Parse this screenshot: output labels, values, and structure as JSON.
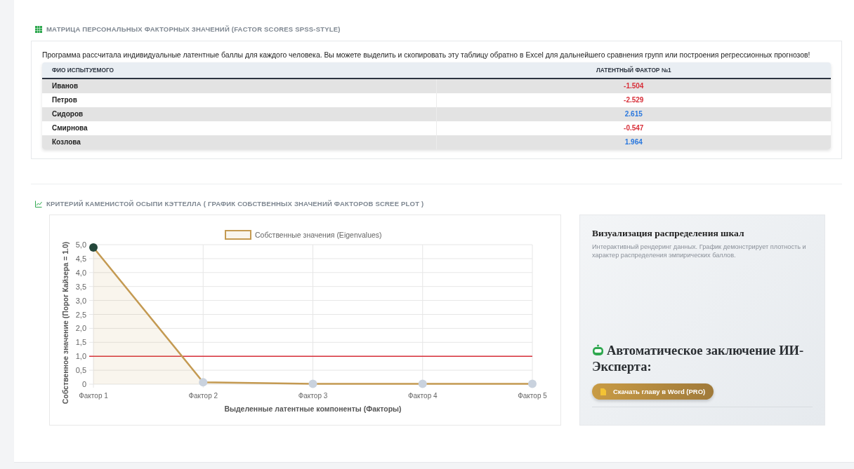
{
  "scores_section": {
    "title": "МАТРИЦА ПЕРСОНАЛЬНЫХ ФАКТОРНЫХ ЗНАЧЕНИЙ (FACTOR SCORES SPSS-STYLE)",
    "description": "Программа рассчитала индивидуальные латентные баллы для каждого человека. Вы можете выделить и скопировать эту таблицу обратно в Excel для дальнейшего сравнения групп или построения регрессионных прогнозов!",
    "table": {
      "columns": [
        "ФИО ИСПЫТУЕМОГО",
        "ЛАТЕНТНЫЙ ФАКТОР №1"
      ],
      "rows": [
        {
          "name": "Иванов",
          "score": "-1.504",
          "color": "#d8303a"
        },
        {
          "name": "Петров",
          "score": "-2.529",
          "color": "#d8303a"
        },
        {
          "name": "Сидоров",
          "score": "2.615",
          "color": "#2a78de"
        },
        {
          "name": "Смирнова",
          "score": "-0.547",
          "color": "#d8303a"
        },
        {
          "name": "Козлова",
          "score": "1.964",
          "color": "#2a78de"
        }
      ]
    }
  },
  "scree_section": {
    "title": "КРИТЕРИЙ КАМЕНИСТОЙ ОСЫПИ КЭТТЕЛЛА ( ГРАФИК СОБСТВЕННЫХ ЗНАЧЕНИЙ ФАКТОРОВ SCREE PLOT )",
    "chart_data": {
      "type": "area",
      "xlabel": "Выделенные латентные компоненты (Факторы)",
      "ylabel": "Собственное значение (Порог Кайзера = 1.0)",
      "categories": [
        "Фактор 1",
        "Фактор 2",
        "Фактор 3",
        "Фактор 4",
        "Фактор 5"
      ],
      "series": [
        {
          "name": "Собственные значения (Eigenvalues)",
          "color": "#c49a52",
          "values": [
            4.9,
            0.07,
            0.01,
            0.01,
            0.01
          ]
        }
      ],
      "ylim": [
        0,
        5
      ],
      "yticks": [
        {
          "value": 0,
          "label": "0"
        },
        {
          "value": 0.5,
          "label": "0,5"
        },
        {
          "value": 1,
          "label": "1,0"
        },
        {
          "value": 1.5,
          "label": "1,5"
        },
        {
          "value": 2,
          "label": "2,0"
        },
        {
          "value": 2.5,
          "label": "2,5"
        },
        {
          "value": 3,
          "label": "3,0"
        },
        {
          "value": 3.5,
          "label": "3,5"
        },
        {
          "value": 4,
          "label": "4,0"
        },
        {
          "value": 4.5,
          "label": "4,5"
        },
        {
          "value": 5,
          "label": "5,0"
        }
      ],
      "grid": true,
      "ref_lines": [
        {
          "axis": "y",
          "value": 1,
          "color": "#d8303a"
        }
      ]
    },
    "side_card": {
      "title": "Визуализация распределения шкал",
      "description": "Интерактивный рендеринг данных. График демонстрирует плотность и характер распределения эмпирических баллов.",
      "conclusion_title": "Автоматическое заключение ИИ-Эксперта:",
      "download_button": "Скачать главу в Word (PRO)"
    }
  }
}
